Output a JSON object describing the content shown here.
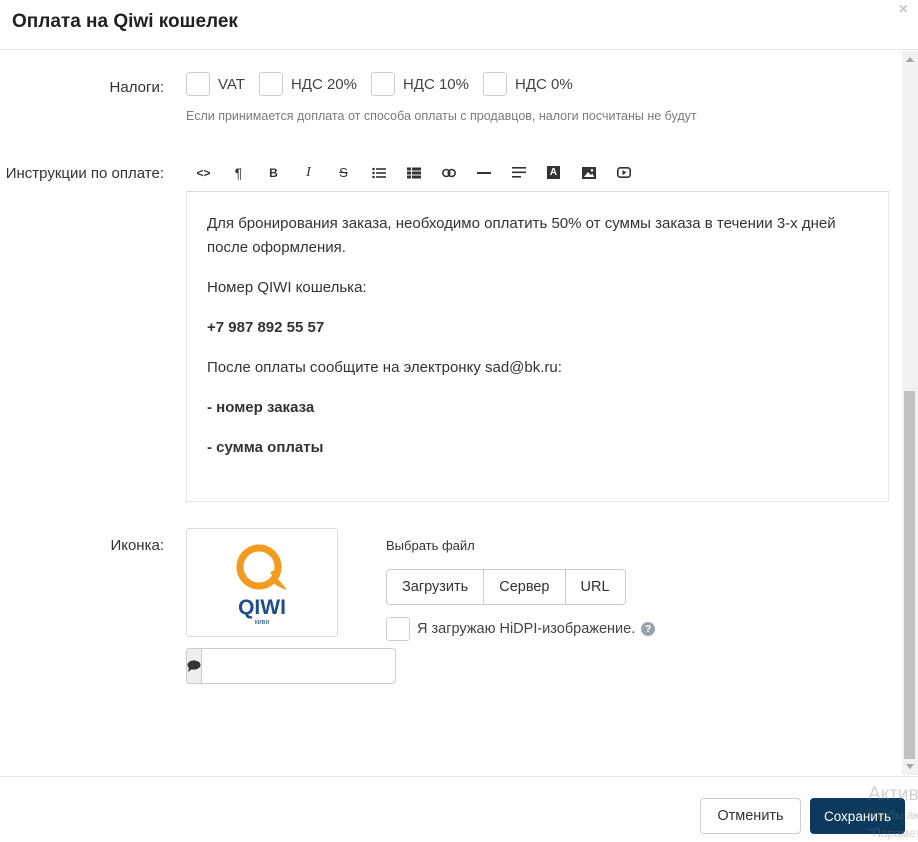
{
  "dialog": {
    "title": "Оплата на Qiwi кошелек",
    "close_glyph": "×"
  },
  "taxes": {
    "label": "Налоги:",
    "options": [
      {
        "label": "VAT",
        "checked": false
      },
      {
        "label": "НДС 20%",
        "checked": false
      },
      {
        "label": "НДС 10%",
        "checked": false
      },
      {
        "label": "НДС 0%",
        "checked": false
      }
    ],
    "hint": "Если принимается доплата от способа оплаты с продавцов, налоги посчитаны не будут"
  },
  "instructions": {
    "label": "Инструкции по оплате:",
    "toolbar": [
      {
        "icon": "code-view-icon",
        "glyph": "<>"
      },
      {
        "icon": "paragraph-icon",
        "glyph": "¶"
      },
      {
        "icon": "bold-icon",
        "glyph": "B"
      },
      {
        "icon": "italic-icon",
        "glyph": "I"
      },
      {
        "icon": "strikethrough-icon",
        "glyph": "S"
      },
      {
        "icon": "unordered-list-icon",
        "glyph": ""
      },
      {
        "icon": "ordered-list-icon",
        "glyph": ""
      },
      {
        "icon": "link-icon",
        "glyph": ""
      },
      {
        "icon": "horizontal-rule-icon",
        "glyph": ""
      },
      {
        "icon": "align-icon",
        "glyph": ""
      },
      {
        "icon": "font-color-icon",
        "glyph": "A"
      },
      {
        "icon": "image-icon",
        "glyph": ""
      },
      {
        "icon": "video-icon",
        "glyph": ""
      }
    ],
    "paragraphs": [
      {
        "text": "Для бронирования заказа, необходимо оплатить 50% от суммы заказа в течении 3-х дней после оформления.",
        "bold": false
      },
      {
        "text": "Номер QIWI кошелька:",
        "bold": false
      },
      {
        "text": "+7 987 892 55 57",
        "bold": true
      },
      {
        "text": "После оплаты сообщите на электронку sad@bk.ru:",
        "bold": false
      },
      {
        "text": "- номер заказа",
        "bold": true
      },
      {
        "text": "- сумма оплаты",
        "bold": true
      }
    ]
  },
  "icon": {
    "label": "Иконка:",
    "logo_text": "QIWI",
    "logo_subtext": "киви",
    "alt_value": "",
    "file_label": "Выбрать файл",
    "source_buttons": [
      "Загрузить",
      "Сервер",
      "URL"
    ],
    "hidpi_label": "Я загружаю HiDPI-изображение.",
    "help_glyph": "?"
  },
  "footer": {
    "cancel_label": "Отменить",
    "save_label": "Сохранить"
  },
  "watermark": {
    "line1": "Активация Windows",
    "line2": "Чтобы активировать Windows, перейдите в раздел",
    "line3": "\"Параметры\"."
  },
  "colors": {
    "primary": "#0d3a5c",
    "qiwi_orange": "#f39b1f",
    "qiwi_blue": "#1f4d8c"
  }
}
